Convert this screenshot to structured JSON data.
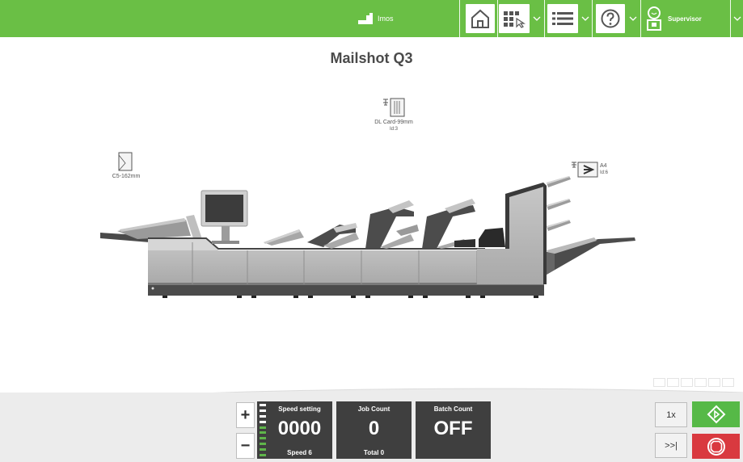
{
  "header": {
    "brand": "Imos",
    "user": "Supervisor"
  },
  "job": {
    "title": "Mailshot Q3"
  },
  "documents": {
    "envelope": {
      "label": "C5-162mm"
    },
    "card": {
      "label": "DL Card-99mm",
      "id": "Id:3"
    },
    "sheet": {
      "label": "A4",
      "id": "Id:6"
    }
  },
  "controls": {
    "plus": "+",
    "minus": "−",
    "speed": {
      "title": "Speed setting",
      "value": "0000",
      "sub": "Speed 6",
      "level": 6,
      "max_level": 10
    },
    "job_count": {
      "title": "Job Count",
      "value": "0",
      "sub": "Total 0"
    },
    "batch_count": {
      "title": "Batch Count",
      "value": "OFF"
    },
    "single_cycle": "1x",
    "skip": ">>|"
  },
  "colors": {
    "accent": "#6abf45",
    "start": "#56b947",
    "stop": "#d9393f",
    "panel": "#3f3f3f"
  }
}
